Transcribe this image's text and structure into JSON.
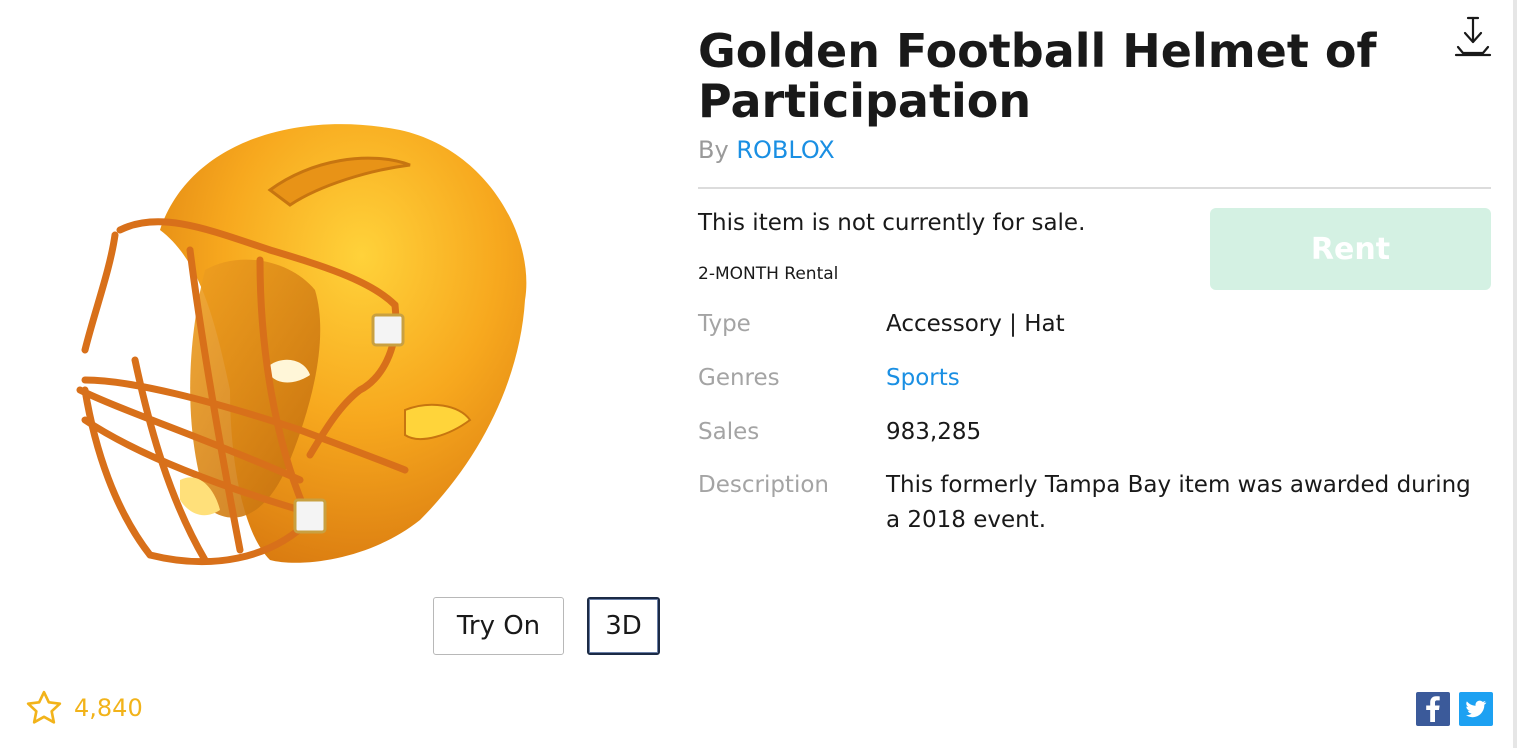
{
  "item": {
    "title": "Golden Football Helmet of Participation",
    "by_prefix": "By",
    "creator": "ROBLOX"
  },
  "purchase": {
    "sale_status": "This item is not currently for sale.",
    "rental_label": "2-MONTH Rental",
    "rent_button": "Rent"
  },
  "details": {
    "type_label": "Type",
    "type_value": "Accessory | Hat",
    "genres_label": "Genres",
    "genres_value": "Sports",
    "sales_label": "Sales",
    "sales_value": "983,285",
    "description_label": "Description",
    "description_value": "This formerly Tampa Bay item was awarded during a 2018 event."
  },
  "thumbnail": {
    "try_on_label": "Try On",
    "three_d_label": "3D"
  },
  "favorites": {
    "count": "4,840",
    "icon": "star-outline-icon"
  },
  "icons": {
    "download": "download-icon",
    "facebook": "facebook-icon",
    "twitter": "twitter-icon"
  },
  "colors": {
    "link": "#1a8fe3",
    "rent_button_bg": "#d4f1e3",
    "favorite": "#f2b31a",
    "facebook": "#3b5a9a",
    "twitter": "#1da1f2"
  }
}
